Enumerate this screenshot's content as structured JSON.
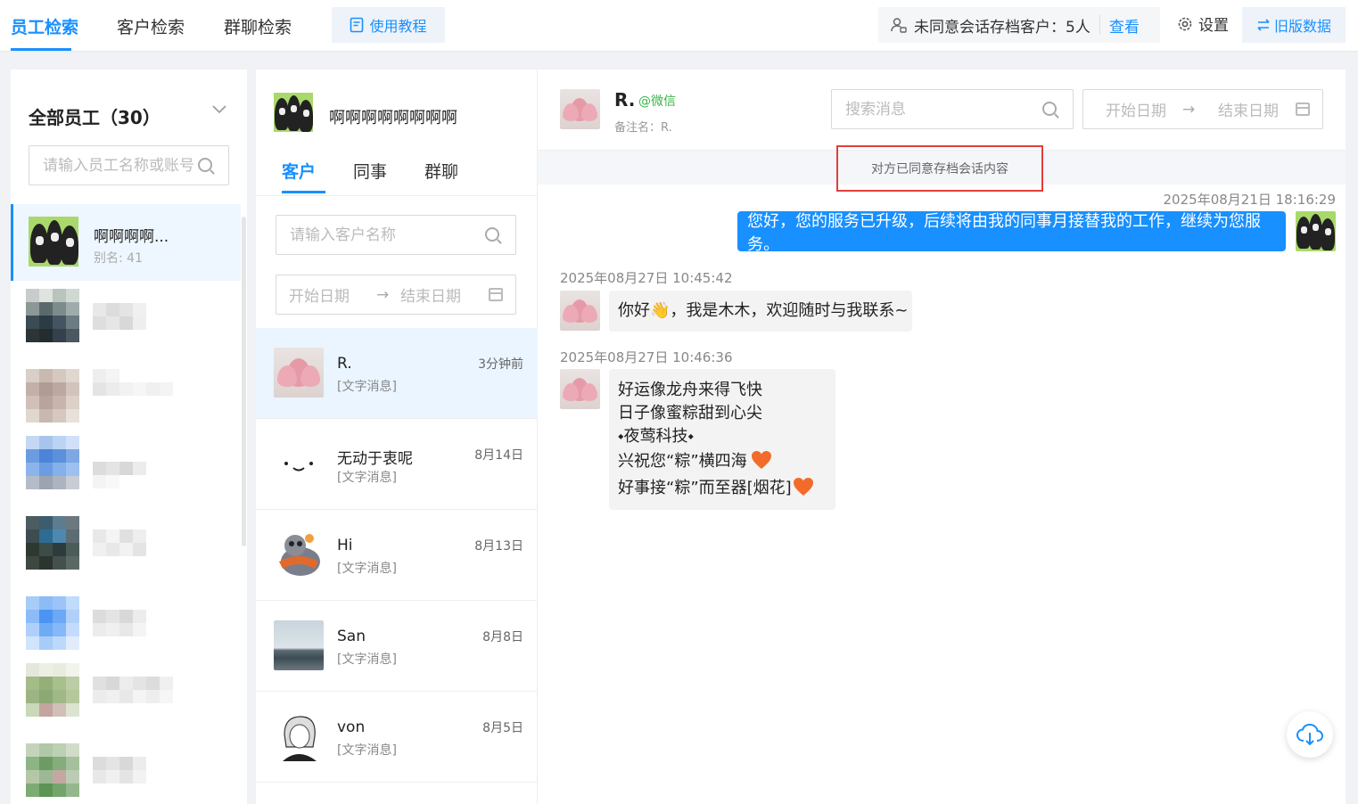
{
  "top": {
    "tabs": [
      "员工检索",
      "客户检索",
      "群聊检索"
    ],
    "tutorial": "使用教程",
    "unconsented_label": "未同意会话存档客户：5人",
    "view": "查看",
    "settings": "设置",
    "old_data": "旧版数据"
  },
  "employees": {
    "title": "全部员工（30）",
    "search_placeholder": "请输入员工名称或账号",
    "selected": {
      "name": "啊啊啊啊...",
      "alias": "别名: 41"
    }
  },
  "middle": {
    "employee_name": "啊啊啊啊啊啊啊啊",
    "tabs": [
      "客户",
      "同事",
      "群聊"
    ],
    "search_placeholder": "请输入客户名称",
    "start_date": "开始日期",
    "end_date": "结束日期",
    "conversations": [
      {
        "name": "R.",
        "preview": "[文字消息]",
        "time": "3分钟前"
      },
      {
        "name": "无动于衷呢",
        "preview": "[文字消息]",
        "time": "8月14日"
      },
      {
        "name": "Hi",
        "preview": "[文字消息]",
        "time": "8月13日"
      },
      {
        "name": "San",
        "preview": "[文字消息]",
        "time": "8月8日"
      },
      {
        "name": "von",
        "preview": "[文字消息]",
        "time": "8月5日"
      }
    ]
  },
  "chat": {
    "name": "R.",
    "source": "@微信",
    "remark": "备注名：R.",
    "search_placeholder": "搜索消息",
    "start_date": "开始日期",
    "end_date": "结束日期",
    "consent": "对方已同意存档会话内容",
    "messages": [
      {
        "time": "2025年08月21日 18:16:29",
        "text": "您好，您的服务已升级，后续将由我的同事月接替我的工作，继续为您服务。"
      },
      {
        "time": "2025年08月27日 10:45:42",
        "text_before": "你好",
        "emoji": "👋",
        "text_after": "，我是木木，欢迎随时与我联系~"
      },
      {
        "time": "2025年08月27日 10:46:36",
        "lines": [
          "好运像龙舟来得飞快",
          "日子像蜜粽甜到心尖",
          "⬩夜莺科技⬩",
          "兴祝您“粽”横四海",
          "好事接“粽”而至器[烟花]"
        ]
      }
    ]
  },
  "colors": {
    "accent": "#1890ff",
    "highlight": "#e0403a",
    "wechat": "#39b54a"
  }
}
